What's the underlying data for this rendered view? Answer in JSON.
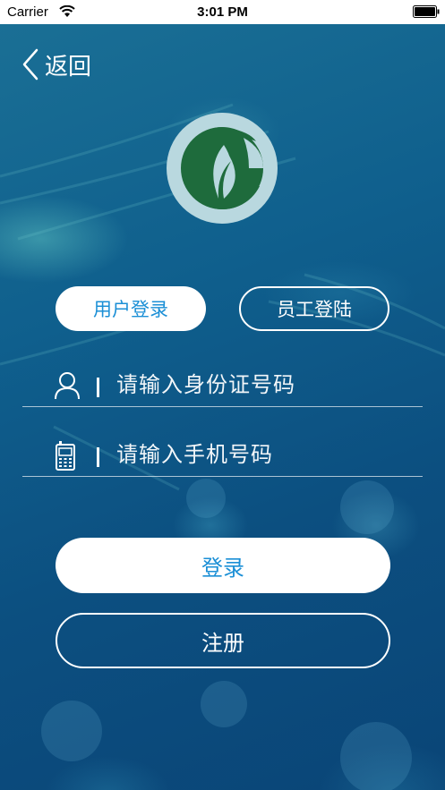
{
  "status_bar": {
    "carrier": "Carrier",
    "time": "3:01 PM"
  },
  "nav": {
    "back_label": "返回"
  },
  "tabs": [
    {
      "label": "用户登录",
      "selected": true
    },
    {
      "label": "员工登陆",
      "selected": false
    }
  ],
  "form": {
    "id_placeholder": "请输入身份证号码",
    "id_value": "",
    "phone_placeholder": "请输入手机号码",
    "phone_value": ""
  },
  "buttons": {
    "login_label": "登录",
    "register_label": "注册"
  },
  "colors": {
    "accent": "#1b8fd6",
    "logo_green": "#1e6b3c",
    "logo_ring": "#b9d8df",
    "background": "#0d5a86"
  },
  "icons": {
    "back": "chevron-left-icon",
    "user": "user-icon",
    "phone": "phone-icon",
    "logo": "leaf-logo-icon"
  }
}
